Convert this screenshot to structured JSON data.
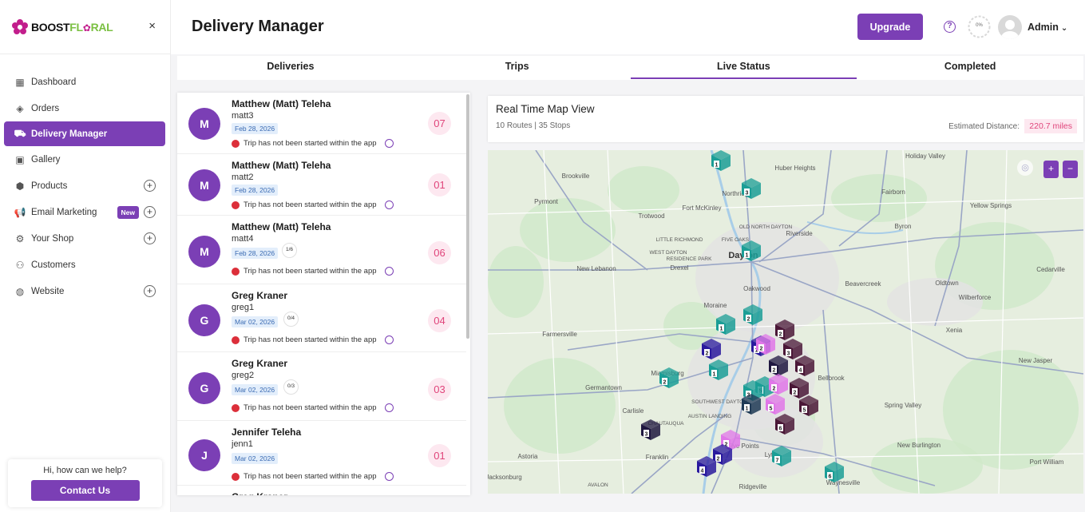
{
  "brand": {
    "part1": "BOOST",
    "part2": "FL",
    "part3": "RAL"
  },
  "sidebar": {
    "close_glyph": "×",
    "items": [
      {
        "label": "Dashboard",
        "icon": "grid-icon"
      },
      {
        "label": "Orders",
        "icon": "layers-icon"
      },
      {
        "label": "Delivery Manager",
        "icon": "truck-icon",
        "active": true
      },
      {
        "label": "Gallery",
        "icon": "image-icon"
      },
      {
        "label": "Products",
        "icon": "box-icon",
        "expandable": true
      },
      {
        "label": "Email Marketing",
        "icon": "megaphone-icon",
        "expandable": true,
        "badge": "New"
      },
      {
        "label": "Your Shop",
        "icon": "gear-icon",
        "expandable": true
      },
      {
        "label": "Customers",
        "icon": "users-icon"
      },
      {
        "label": "Website",
        "icon": "globe-icon",
        "expandable": true
      }
    ],
    "help_question": "Hi, how can we help?",
    "contact_label": "Contact Us"
  },
  "header": {
    "title": "Delivery Manager",
    "upgrade_label": "Upgrade",
    "help_glyph": "?",
    "progress_text": "0%",
    "user_name": "Admin",
    "chevron": "⌄"
  },
  "tabs": [
    {
      "label": "Deliveries",
      "active": false
    },
    {
      "label": "Trips",
      "active": false
    },
    {
      "label": "Live Status",
      "active": true
    },
    {
      "label": "Completed",
      "active": false
    }
  ],
  "drivers": [
    {
      "initial": "M",
      "name": "Matthew (Matt) Teleha",
      "username": "matt3",
      "date": "Feb 28, 2026",
      "progress": "",
      "status": "Trip has not been started within the app",
      "count": "07"
    },
    {
      "initial": "M",
      "name": "Matthew (Matt) Teleha",
      "username": "matt2",
      "date": "Feb 28, 2026",
      "progress": "",
      "status": "Trip has not been started within the app",
      "count": "01"
    },
    {
      "initial": "M",
      "name": "Matthew (Matt) Teleha",
      "username": "matt4",
      "date": "Feb 28, 2026",
      "progress": "1/6",
      "status": "Trip has not been started within the app",
      "count": "06"
    },
    {
      "initial": "G",
      "name": "Greg Kraner",
      "username": "greg1",
      "date": "Mar 02, 2026",
      "progress": "0/4",
      "status": "Trip has not been started within the app",
      "count": "04"
    },
    {
      "initial": "G",
      "name": "Greg Kraner",
      "username": "greg2",
      "date": "Mar 02, 2026",
      "progress": "0/3",
      "status": "Trip has not been started within the app",
      "count": "03"
    },
    {
      "initial": "J",
      "name": "Jennifer Teleha",
      "username": "jenn1",
      "date": "Mar 02, 2026",
      "progress": "",
      "status": "Trip has not been started within the app",
      "count": "01"
    },
    {
      "initial": "G",
      "name": "Greg Kraner",
      "username": "",
      "date": "",
      "progress": "",
      "status": "",
      "count": ""
    }
  ],
  "map_panel": {
    "title": "Real Time Map View",
    "summary": "10 Routes | 35 Stops",
    "distance_label": "Estimated Distance:",
    "distance_value": "220.7 miles",
    "zoom_in": "+",
    "zoom_out": "−"
  },
  "map": {
    "places": [
      {
        "name": "Brookville",
        "size": "small"
      },
      {
        "name": "Pyrmont",
        "size": "small"
      },
      {
        "name": "Trotwood",
        "size": "small"
      },
      {
        "name": "Fort McKinley",
        "size": "small"
      },
      {
        "name": "Northridge",
        "size": "small"
      },
      {
        "name": "Huber Heights",
        "size": "small"
      },
      {
        "name": "Fairborn",
        "size": "small"
      },
      {
        "name": "Holiday Valley",
        "size": "small"
      },
      {
        "name": "Yellow Springs",
        "size": "small"
      },
      {
        "name": "Byron",
        "size": "small"
      },
      {
        "name": "LITTLE RICHMOND",
        "size": "tiny"
      },
      {
        "name": "WEST DAYTON",
        "size": "tiny"
      },
      {
        "name": "RESIDENCE PARK",
        "size": "tiny"
      },
      {
        "name": "FIVE OAKS",
        "size": "tiny"
      },
      {
        "name": "OLD NORTH DAYTON",
        "size": "tiny"
      },
      {
        "name": "Riverside",
        "size": "small"
      },
      {
        "name": "Dayton",
        "size": "large"
      },
      {
        "name": "New Lebanon",
        "size": "small"
      },
      {
        "name": "Drexel",
        "size": "small"
      },
      {
        "name": "Oakwood",
        "size": "small"
      },
      {
        "name": "Beavercreek",
        "size": "small"
      },
      {
        "name": "Oldtown",
        "size": "small"
      },
      {
        "name": "Cedarville",
        "size": "small"
      },
      {
        "name": "Wilberforce",
        "size": "small"
      },
      {
        "name": "Xenia",
        "size": "small"
      },
      {
        "name": "Farmersville",
        "size": "small"
      },
      {
        "name": "Moraine",
        "size": "small"
      },
      {
        "name": "Miamisburg",
        "size": "small"
      },
      {
        "name": "Germantown",
        "size": "small"
      },
      {
        "name": "Bellbrook",
        "size": "small"
      },
      {
        "name": "New Jasper",
        "size": "small"
      },
      {
        "name": "SOUTHWEST DAYTON",
        "size": "tiny"
      },
      {
        "name": "AUSTIN LANDING",
        "size": "tiny"
      },
      {
        "name": "CHAUTAUQUA",
        "size": "tiny"
      },
      {
        "name": "Carlisle",
        "size": "small"
      },
      {
        "name": "Spring Valley",
        "size": "small"
      },
      {
        "name": "Five Points",
        "size": "small"
      },
      {
        "name": "Lytle",
        "size": "small"
      },
      {
        "name": "New Burlington",
        "size": "small"
      },
      {
        "name": "Astoria",
        "size": "small"
      },
      {
        "name": "Franklin",
        "size": "small"
      },
      {
        "name": "Port William",
        "size": "small"
      },
      {
        "name": "Jacksonburg",
        "size": "small"
      },
      {
        "name": "AVALON",
        "size": "tiny"
      },
      {
        "name": "Ridgeville",
        "size": "small"
      },
      {
        "name": "Waynesville",
        "size": "small"
      }
    ],
    "markers": [
      {
        "label": "1",
        "color": "#1b9e96"
      },
      {
        "label": "3",
        "color": "#1b9e96"
      },
      {
        "label": "1",
        "color": "#1b9e96"
      },
      {
        "label": "2",
        "color": "#1b9e96"
      },
      {
        "label": "1",
        "color": "#1b9e96"
      },
      {
        "label": "2",
        "color": "#2a1a9e"
      },
      {
        "label": "1",
        "color": "#2a1a9e"
      },
      {
        "label": "2",
        "color": "#e077e8"
      },
      {
        "label": "2",
        "color": "#4a1737"
      },
      {
        "label": "3",
        "color": "#4a1737"
      },
      {
        "label": "2",
        "color": "#1f1740"
      },
      {
        "label": "4",
        "color": "#4a1737"
      },
      {
        "label": "2",
        "color": "#1b9e96"
      },
      {
        "label": "1",
        "color": "#1b9e96"
      },
      {
        "label": "5",
        "color": "#1b9e96"
      },
      {
        "label": "3",
        "color": "#1b9e96"
      },
      {
        "label": "2",
        "color": "#e077e8"
      },
      {
        "label": "2",
        "color": "#4a1737"
      },
      {
        "label": "1",
        "color": "#1f3a55"
      },
      {
        "label": "5",
        "color": "#e077e8"
      },
      {
        "label": "5",
        "color": "#4a1737"
      },
      {
        "label": "6",
        "color": "#4a1737"
      },
      {
        "label": "3",
        "color": "#1f1740"
      },
      {
        "label": "2",
        "color": "#e077e8"
      },
      {
        "label": "2",
        "color": "#2a1a9e"
      },
      {
        "label": "4",
        "color": "#2a1a9e"
      },
      {
        "label": "7",
        "color": "#1b9e96"
      },
      {
        "label": "6",
        "color": "#1b9e96"
      }
    ]
  }
}
